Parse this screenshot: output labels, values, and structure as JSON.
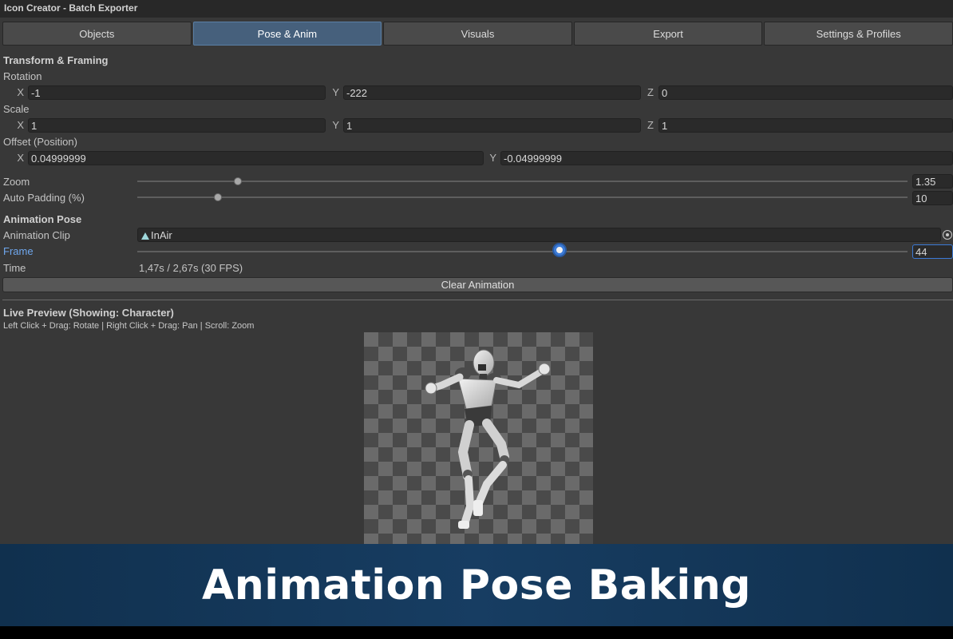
{
  "window": {
    "title": "Icon Creator - Batch Exporter"
  },
  "tabs": [
    {
      "label": "Objects",
      "active": false
    },
    {
      "label": "Pose & Anim",
      "active": true
    },
    {
      "label": "Visuals",
      "active": false
    },
    {
      "label": "Export",
      "active": false
    },
    {
      "label": "Settings & Profiles",
      "active": false
    }
  ],
  "transform": {
    "header": "Transform & Framing",
    "rotation": {
      "label": "Rotation",
      "x": "-1",
      "y": "-222",
      "z": "0"
    },
    "scale": {
      "label": "Scale",
      "x": "1",
      "y": "1",
      "z": "1"
    },
    "offset": {
      "label": "Offset (Position)",
      "x": "0.04999999",
      "y": "-0.04999999"
    },
    "axis": {
      "x": "X",
      "y": "Y",
      "z": "Z"
    }
  },
  "zoom": {
    "label": "Zoom",
    "value": "1.35",
    "fraction": 0.13
  },
  "padding": {
    "label": "Auto Padding (%)",
    "value": "10",
    "fraction": 0.1
  },
  "animation": {
    "header": "Animation Pose",
    "clip_label": "Animation Clip",
    "clip_value": "InAir",
    "frame_label": "Frame",
    "frame_value": "44",
    "frame_fraction": 0.55,
    "time_label": "Time",
    "time_value": "1,47s / 2,67s  (30 FPS)",
    "clear_button": "Clear Animation"
  },
  "preview": {
    "header": "Live Preview (Showing: Character)",
    "hint": "Left Click + Drag: Rotate | Right Click + Drag: Pan | Scroll: Zoom"
  },
  "banner": {
    "title": "Animation Pose Baking"
  },
  "colors": {
    "accent": "#3b7ad6",
    "tab_active": "#46607c",
    "banner": "#173d62"
  }
}
